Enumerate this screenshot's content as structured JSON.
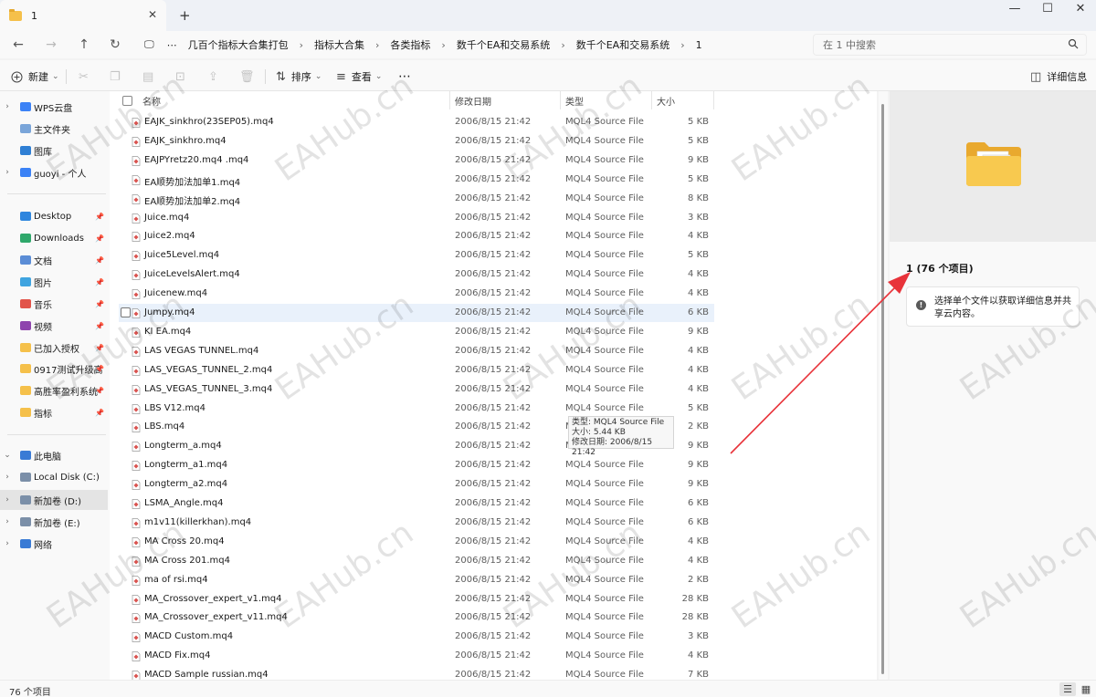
{
  "window": {
    "tab_title": "1",
    "tab_close": "✕",
    "new_tab": "+",
    "controls": {
      "minimize": "—",
      "maximize": "☐",
      "close": "✕"
    }
  },
  "nav": {
    "back": "←",
    "forward": "→",
    "up": "↑",
    "refresh": "↻",
    "monitor": "🖵",
    "overflow": "⋯",
    "breadcrumbs": [
      "几百个指标大合集打包",
      "指标大合集",
      "各类指标",
      "数千个EA和交易系统",
      "数千个EA和交易系统",
      "1"
    ],
    "separator": "›"
  },
  "search": {
    "placeholder": "在 1 中搜索"
  },
  "toolbar": {
    "new_label": "新建",
    "new_caret": "⌄",
    "sort_label": "排序",
    "view_label": "查看",
    "more": "⋯",
    "details_label": "详细信息"
  },
  "sidebar": {
    "items": [
      {
        "label": "WPS云盘",
        "chev": "›",
        "color": "#3b82f6",
        "pinned": false
      },
      {
        "label": "主文件夹",
        "chev": "",
        "color": "#7aa5d9",
        "pinned": false
      },
      {
        "label": "图库",
        "chev": "",
        "color": "#2f7fd4",
        "pinned": false
      },
      {
        "label": "guoyi - 个人",
        "chev": "›",
        "color": "#3b82f6",
        "pinned": false
      },
      {
        "label": "Desktop",
        "chev": "",
        "color": "#2e86de",
        "pinned": true
      },
      {
        "label": "Downloads",
        "chev": "",
        "color": "#2fa86b",
        "pinned": true
      },
      {
        "label": "文档",
        "chev": "",
        "color": "#5b8dd6",
        "pinned": true
      },
      {
        "label": "图片",
        "chev": "",
        "color": "#3fa4e0",
        "pinned": true
      },
      {
        "label": "音乐",
        "chev": "",
        "color": "#e2544a",
        "pinned": true
      },
      {
        "label": "视频",
        "chev": "",
        "color": "#8e44ad",
        "pinned": true
      },
      {
        "label": "已加入授权",
        "chev": "",
        "color": "#f5c04a",
        "pinned": true
      },
      {
        "label": "0917测试升级高",
        "chev": "",
        "color": "#f5c04a",
        "pinned": true
      },
      {
        "label": "高胜率盈利系统",
        "chev": "",
        "color": "#f5c04a",
        "pinned": true
      },
      {
        "label": "指标",
        "chev": "",
        "color": "#f5c04a",
        "pinned": true
      },
      {
        "label": "此电脑",
        "chev": "⌄",
        "color": "#3a7bd5",
        "pinned": false
      },
      {
        "label": "Local Disk (C:)",
        "chev": "›",
        "color": "#7b8fa8",
        "pinned": false
      },
      {
        "label": "新加卷 (D:)",
        "chev": "›",
        "color": "#7b8fa8",
        "pinned": false
      },
      {
        "label": "新加卷 (E:)",
        "chev": "›",
        "color": "#7b8fa8",
        "pinned": false
      },
      {
        "label": "网络",
        "chev": "›",
        "color": "#3a7bd5",
        "pinned": false
      }
    ],
    "pin_glyph": "📌"
  },
  "columns": {
    "name": "名称",
    "date": "修改日期",
    "type": "类型",
    "size": "大小"
  },
  "files": [
    {
      "name": "EAJK_sinkhro(23SEP05).mq4",
      "date": "2006/8/15 21:42",
      "type": "MQL4 Source File",
      "size": "5 KB"
    },
    {
      "name": "EAJK_sinkhro.mq4",
      "date": "2006/8/15 21:42",
      "type": "MQL4 Source File",
      "size": "5 KB"
    },
    {
      "name": "EAJPYretz20.mq4  .mq4",
      "date": "2006/8/15 21:42",
      "type": "MQL4 Source File",
      "size": "9 KB"
    },
    {
      "name": "EA顺势加法加单1.mq4",
      "date": "2006/8/15 21:42",
      "type": "MQL4 Source File",
      "size": "5 KB"
    },
    {
      "name": "EA顺势加法加单2.mq4",
      "date": "2006/8/15 21:42",
      "type": "MQL4 Source File",
      "size": "8 KB"
    },
    {
      "name": "Juice.mq4",
      "date": "2006/8/15 21:42",
      "type": "MQL4 Source File",
      "size": "3 KB"
    },
    {
      "name": "Juice2.mq4",
      "date": "2006/8/15 21:42",
      "type": "MQL4 Source File",
      "size": "4 KB"
    },
    {
      "name": "Juice5Level.mq4",
      "date": "2006/8/15 21:42",
      "type": "MQL4 Source File",
      "size": "5 KB"
    },
    {
      "name": "JuiceLevelsAlert.mq4",
      "date": "2006/8/15 21:42",
      "type": "MQL4 Source File",
      "size": "4 KB"
    },
    {
      "name": "Juicenew.mq4",
      "date": "2006/8/15 21:42",
      "type": "MQL4 Source File",
      "size": "4 KB"
    },
    {
      "name": "Jumpy.mq4",
      "date": "2006/8/15 21:42",
      "type": "MQL4 Source File",
      "size": "6 KB"
    },
    {
      "name": "KI EA.mq4",
      "date": "2006/8/15 21:42",
      "type": "MQL4 Source File",
      "size": "9 KB"
    },
    {
      "name": "LAS VEGAS TUNNEL.mq4",
      "date": "2006/8/15 21:42",
      "type": "MQL4 Source File",
      "size": "4 KB"
    },
    {
      "name": "LAS_VEGAS_TUNNEL_2.mq4",
      "date": "2006/8/15 21:42",
      "type": "MQL4 Source File",
      "size": "4 KB"
    },
    {
      "name": "LAS_VEGAS_TUNNEL_3.mq4",
      "date": "2006/8/15 21:42",
      "type": "MQL4 Source File",
      "size": "4 KB"
    },
    {
      "name": "LBS V12.mq4",
      "date": "2006/8/15 21:42",
      "type": "MQL4 Source File",
      "size": "5 KB"
    },
    {
      "name": "LBS.mq4",
      "date": "2006/8/15 21:42",
      "type": "MQL4 Source File",
      "size": "2 KB"
    },
    {
      "name": "Longterm_a.mq4",
      "date": "2006/8/15 21:42",
      "type": "MQL4 Source File",
      "size": "9 KB"
    },
    {
      "name": "Longterm_a1.mq4",
      "date": "2006/8/15 21:42",
      "type": "MQL4 Source File",
      "size": "9 KB"
    },
    {
      "name": "Longterm_a2.mq4",
      "date": "2006/8/15 21:42",
      "type": "MQL4 Source File",
      "size": "9 KB"
    },
    {
      "name": "LSMA_Angle.mq4",
      "date": "2006/8/15 21:42",
      "type": "MQL4 Source File",
      "size": "6 KB"
    },
    {
      "name": "m1v11(killerkhan).mq4",
      "date": "2006/8/15 21:42",
      "type": "MQL4 Source File",
      "size": "6 KB"
    },
    {
      "name": "MA Cross 20.mq4",
      "date": "2006/8/15 21:42",
      "type": "MQL4 Source File",
      "size": "4 KB"
    },
    {
      "name": "MA Cross 201.mq4",
      "date": "2006/8/15 21:42",
      "type": "MQL4 Source File",
      "size": "4 KB"
    },
    {
      "name": "ma of rsi.mq4",
      "date": "2006/8/15 21:42",
      "type": "MQL4 Source File",
      "size": "2 KB"
    },
    {
      "name": "MA_Crossover_expert_v1.mq4",
      "date": "2006/8/15 21:42",
      "type": "MQL4 Source File",
      "size": "28 KB"
    },
    {
      "name": "MA_Crossover_expert_v11.mq4",
      "date": "2006/8/15 21:42",
      "type": "MQL4 Source File",
      "size": "28 KB"
    },
    {
      "name": "MACD Custom.mq4",
      "date": "2006/8/15 21:42",
      "type": "MQL4 Source File",
      "size": "3 KB"
    },
    {
      "name": "MACD Fix.mq4",
      "date": "2006/8/15 21:42",
      "type": "MQL4 Source File",
      "size": "4 KB"
    },
    {
      "name": "MACD Sample russian.mq4",
      "date": "2006/8/15 21:42",
      "type": "MQL4 Source File",
      "size": "7 KB"
    }
  ],
  "tooltip": {
    "type_line": "类型: MQL4 Source File",
    "size_line": "大小: 5.44 KB",
    "date_line": "修改日期: 2006/8/15 21:42"
  },
  "details": {
    "title": "1 (76 个项目)",
    "info_glyph": "!",
    "message": "选择单个文件以获取详细信息并共享云内容。"
  },
  "status": {
    "count": "76 个项目"
  },
  "watermark": "EAHub.cn",
  "colors": {
    "accent": "#0067c0",
    "folder": "#f5c04a",
    "arrow": "#e8333a",
    "hover_row": "#e9f1fb"
  }
}
